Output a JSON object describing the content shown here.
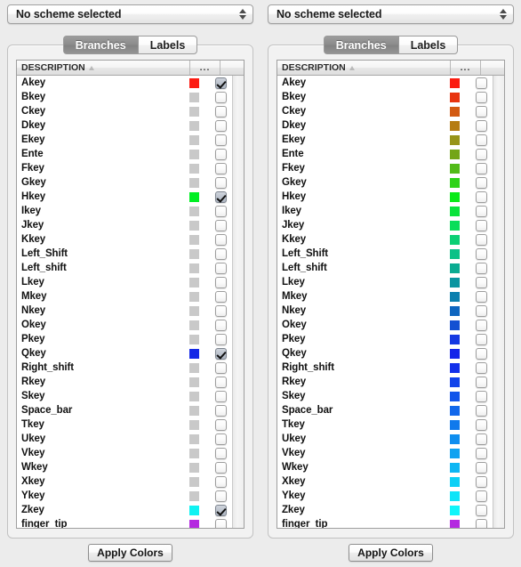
{
  "window": {
    "background": "#ececec"
  },
  "panels": [
    {
      "id": "left",
      "scheme": {
        "selected": "No scheme selected"
      },
      "tabs": [
        {
          "label": "Branches",
          "active": true
        },
        {
          "label": "Labels",
          "active": false
        }
      ],
      "table": {
        "headers": {
          "description": "DESCRIPTION",
          "dots": "...",
          "check": ""
        },
        "sort": "ascending",
        "rows": [
          {
            "description": "Akey",
            "color": "#fc1b12",
            "checked": true
          },
          {
            "description": "Bkey",
            "color": "#c9c9c9",
            "checked": false
          },
          {
            "description": "Ckey",
            "color": "#c9c9c9",
            "checked": false
          },
          {
            "description": "Dkey",
            "color": "#c9c9c9",
            "checked": false
          },
          {
            "description": "Ekey",
            "color": "#c9c9c9",
            "checked": false
          },
          {
            "description": "Ente",
            "color": "#c9c9c9",
            "checked": false
          },
          {
            "description": "Fkey",
            "color": "#c9c9c9",
            "checked": false
          },
          {
            "description": "Gkey",
            "color": "#c9c9c9",
            "checked": false
          },
          {
            "description": "Hkey",
            "color": "#00ef23",
            "checked": true
          },
          {
            "description": "Ikey",
            "color": "#c9c9c9",
            "checked": false
          },
          {
            "description": "Jkey",
            "color": "#c9c9c9",
            "checked": false
          },
          {
            "description": "Kkey",
            "color": "#c9c9c9",
            "checked": false
          },
          {
            "description": "Left_Shift",
            "color": "#c9c9c9",
            "checked": false
          },
          {
            "description": "Left_shift",
            "color": "#c9c9c9",
            "checked": false
          },
          {
            "description": "Lkey",
            "color": "#c9c9c9",
            "checked": false
          },
          {
            "description": "Mkey",
            "color": "#c9c9c9",
            "checked": false
          },
          {
            "description": "Nkey",
            "color": "#c9c9c9",
            "checked": false
          },
          {
            "description": "Okey",
            "color": "#c9c9c9",
            "checked": false
          },
          {
            "description": "Pkey",
            "color": "#c9c9c9",
            "checked": false
          },
          {
            "description": "Qkey",
            "color": "#1428e6",
            "checked": true
          },
          {
            "description": "Right_shift",
            "color": "#c9c9c9",
            "checked": false
          },
          {
            "description": "Rkey",
            "color": "#c9c9c9",
            "checked": false
          },
          {
            "description": "Skey",
            "color": "#c9c9c9",
            "checked": false
          },
          {
            "description": "Space_bar",
            "color": "#c9c9c9",
            "checked": false
          },
          {
            "description": "Tkey",
            "color": "#c9c9c9",
            "checked": false
          },
          {
            "description": "Ukey",
            "color": "#c9c9c9",
            "checked": false
          },
          {
            "description": "Vkey",
            "color": "#c9c9c9",
            "checked": false
          },
          {
            "description": "Wkey",
            "color": "#c9c9c9",
            "checked": false
          },
          {
            "description": "Xkey",
            "color": "#c9c9c9",
            "checked": false
          },
          {
            "description": "Ykey",
            "color": "#c9c9c9",
            "checked": false
          },
          {
            "description": "Zkey",
            "color": "#10f2f2",
            "checked": true
          },
          {
            "description": "finger_tip",
            "color": "#b42ae0",
            "checked": false
          }
        ]
      },
      "apply_button": "Apply Colors"
    },
    {
      "id": "right",
      "scheme": {
        "selected": "No scheme selected"
      },
      "tabs": [
        {
          "label": "Branches",
          "active": true
        },
        {
          "label": "Labels",
          "active": false
        }
      ],
      "table": {
        "headers": {
          "description": "DESCRIPTION",
          "dots": "...",
          "check": ""
        },
        "sort": "ascending",
        "rows": [
          {
            "description": "Akey",
            "color": "#fb1c10",
            "checked": false
          },
          {
            "description": "Bkey",
            "color": "#e8340f",
            "checked": false
          },
          {
            "description": "Ckey",
            "color": "#d25a12",
            "checked": false
          },
          {
            "description": "Dkey",
            "color": "#b57d14",
            "checked": false
          },
          {
            "description": "Ekey",
            "color": "#97941a",
            "checked": false
          },
          {
            "description": "Ente",
            "color": "#74a518",
            "checked": false
          },
          {
            "description": "Fkey",
            "color": "#52bb18",
            "checked": false
          },
          {
            "description": "Gkey",
            "color": "#2ed318",
            "checked": false
          },
          {
            "description": "Hkey",
            "color": "#09ea17",
            "checked": false
          },
          {
            "description": "Ikey",
            "color": "#0ae33b",
            "checked": false
          },
          {
            "description": "Jkey",
            "color": "#0bdd59",
            "checked": false
          },
          {
            "description": "Kkey",
            "color": "#0ccf74",
            "checked": false
          },
          {
            "description": "Left_Shift",
            "color": "#0cc187",
            "checked": false
          },
          {
            "description": "Left_shift",
            "color": "#0bab92",
            "checked": false
          },
          {
            "description": "Lkey",
            "color": "#0b95a0",
            "checked": false
          },
          {
            "description": "Mkey",
            "color": "#0b7fae",
            "checked": false
          },
          {
            "description": "Nkey",
            "color": "#0f66bf",
            "checked": false
          },
          {
            "description": "Okey",
            "color": "#1450d2",
            "checked": false
          },
          {
            "description": "Pkey",
            "color": "#1539e2",
            "checked": false
          },
          {
            "description": "Qkey",
            "color": "#1425e9",
            "checked": false
          },
          {
            "description": "Right_shift",
            "color": "#1331ea",
            "checked": false
          },
          {
            "description": "Rkey",
            "color": "#1244ea",
            "checked": false
          },
          {
            "description": "Skey",
            "color": "#1255ea",
            "checked": false
          },
          {
            "description": "Space_bar",
            "color": "#1167eb",
            "checked": false
          },
          {
            "description": "Tkey",
            "color": "#1079ec",
            "checked": false
          },
          {
            "description": "Ukey",
            "color": "#0f8eef",
            "checked": false
          },
          {
            "description": "Vkey",
            "color": "#0fa2f1",
            "checked": false
          },
          {
            "description": "Wkey",
            "color": "#0eb6f3",
            "checked": false
          },
          {
            "description": "Xkey",
            "color": "#0ed0f6",
            "checked": false
          },
          {
            "description": "Ykey",
            "color": "#0fe4f8",
            "checked": false
          },
          {
            "description": "Zkey",
            "color": "#10f5fa",
            "checked": false
          },
          {
            "description": "finger_tip",
            "color": "#b42ae0",
            "checked": false
          }
        ]
      },
      "apply_button": "Apply Colors"
    }
  ]
}
